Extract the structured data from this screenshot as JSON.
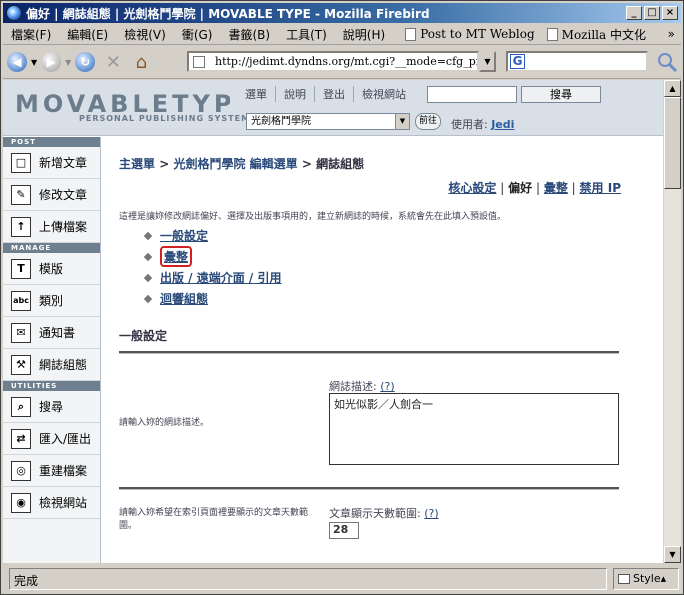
{
  "window": {
    "title": "偏好 | 網誌組態 | 光劍格鬥學院 | MOVABLE TYPE - Mozilla Firebird",
    "buttons": [
      "_",
      "□",
      "×"
    ]
  },
  "menubar": {
    "items": [
      "檔案(F)",
      "編輯(E)",
      "檢視(V)",
      "衝(G)",
      "書籤(B)",
      "工具(T)",
      "說明(H)"
    ],
    "bookmarks": [
      "Post to MT Weblog",
      "Mozilla 中文化"
    ],
    "overflow": "»"
  },
  "navbar": {
    "url": "http://jedimt.dyndns.org/mt.cgi?__mode=cfg_prefs&blo",
    "search_placeholder": "",
    "search_engine": "G"
  },
  "mt_header": {
    "logo": "MOVABLETYPE",
    "tagline": "PERSONAL PUBLISHING SYSTEM",
    "nav": [
      "選單",
      "說明",
      "登出",
      "檢視網站"
    ],
    "search_button": "搜尋",
    "blog_select": "光劍格鬥學院",
    "go_button": "前往",
    "user_label": "使用者:",
    "user_name": "Jedi"
  },
  "sidebar": {
    "sections": [
      {
        "title": "POST",
        "items": [
          {
            "label": "新增文章",
            "icon": "new-entry-icon",
            "glyph": "□"
          },
          {
            "label": "修改文章",
            "icon": "edit-entry-icon",
            "glyph": "✎"
          },
          {
            "label": "上傳檔案",
            "icon": "upload-icon",
            "glyph": "↑"
          }
        ]
      },
      {
        "title": "MANAGE",
        "items": [
          {
            "label": "模版",
            "icon": "template-icon",
            "glyph": "T"
          },
          {
            "label": "類別",
            "icon": "category-icon",
            "glyph": "abc"
          },
          {
            "label": "通知書",
            "icon": "notification-icon",
            "glyph": "✉"
          },
          {
            "label": "網誌組態",
            "icon": "config-icon",
            "glyph": "⚒"
          }
        ]
      },
      {
        "title": "UTILITIES",
        "items": [
          {
            "label": "搜尋",
            "icon": "search-icon",
            "glyph": "⌕"
          },
          {
            "label": "匯入/匯出",
            "icon": "import-export-icon",
            "glyph": "⇄"
          },
          {
            "label": "重建檔案",
            "icon": "rebuild-icon",
            "glyph": "◎"
          },
          {
            "label": "檢視網站",
            "icon": "view-site-icon",
            "glyph": "◉"
          }
        ]
      }
    ]
  },
  "main": {
    "breadcrumb": {
      "home": "主選單",
      "blog": "光劍格鬥學院 編輯選單",
      "current": "網誌組態",
      "sep": ">"
    },
    "tabs": {
      "core": "核心設定",
      "prefs": "偏好",
      "archive": "彙整",
      "ip": "禁用 IP",
      "sep": "|"
    },
    "intro": "這裡是讓妳修改網誌偏好、選擇及出版事項用的，建立新網誌的時候，系統會先在此填入預設值。",
    "links": [
      "一般設定",
      "彙整",
      "出版 / 遠端介面 / 引用",
      "迴響組態"
    ],
    "section_title": "一般設定",
    "field1": {
      "desc": "請輸入妳的網誌描述。",
      "label": "網誌描述:",
      "help": "(?)",
      "value": "如光似影／人劍合一"
    },
    "field2": {
      "desc": "請輸入妳希望在索引頁面裡要顯示的文章天數範圍。",
      "label": "文章顯示天數範圍:",
      "help": "(?)",
      "value": "28"
    }
  },
  "status": {
    "text": "完成",
    "style": "Style▴"
  }
}
